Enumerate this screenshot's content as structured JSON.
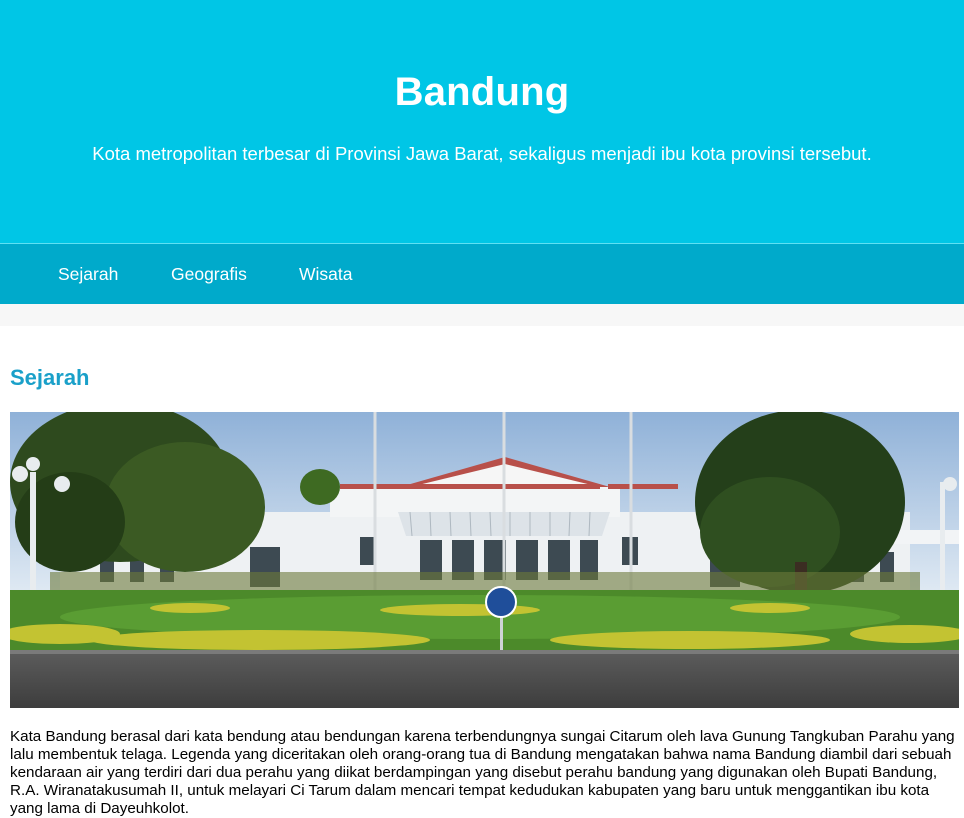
{
  "header": {
    "title": "Bandung",
    "subtitle": "Kota metropolitan terbesar di Provinsi Jawa Barat, sekaligus menjadi ibu kota provinsi tersebut."
  },
  "nav": {
    "items": [
      {
        "label": "Sejarah"
      },
      {
        "label": "Geografis"
      },
      {
        "label": "Wisata"
      }
    ]
  },
  "main": {
    "section_title": "Sejarah",
    "image_subject": "Gedung Sate–style white colonial building with gardens",
    "paragraph": "Kata Bandung berasal dari kata bendung atau bendungan karena terbendungnya sungai Citarum oleh lava Gunung Tangkuban Parahu yang lalu membentuk telaga. Legenda yang diceritakan oleh orang-orang tua di Bandung mengatakan bahwa nama Bandung diambil dari sebuah kendaraan air yang terdiri dari dua perahu yang diikat berdampingan yang disebut perahu bandung yang digunakan oleh Bupati Bandung, R.A. Wiranatakusumah II, untuk melayari Ci Tarum dalam mencari tempat kedudukan kabupaten yang baru untuk menggantikan ibu kota yang lama di Dayeuhkolot."
  },
  "colors": {
    "hero": "#00c6e6",
    "nav": "#00aacb",
    "accent": "#1aa0c9"
  }
}
